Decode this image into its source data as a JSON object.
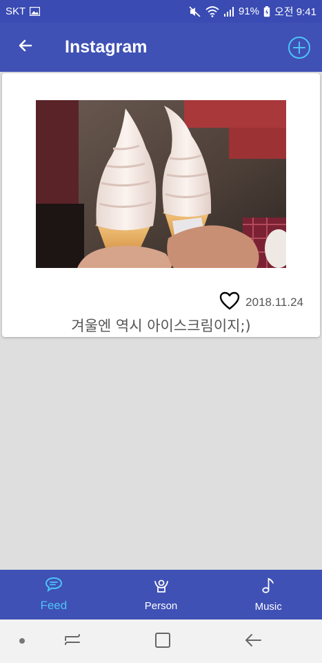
{
  "status_bar": {
    "carrier": "SKT",
    "battery": "91%",
    "time": "오전 9:41",
    "icons": [
      "gallery-icon",
      "mute-icon",
      "wifi-icon",
      "signal-icon",
      "battery-icon"
    ]
  },
  "app_bar": {
    "title": "Instagram",
    "back_icon": "arrow-left-icon",
    "add_icon": "add-circle-icon",
    "accent_color": "#4fc3f7"
  },
  "post": {
    "image_subject": "ice-cream-cones-photo",
    "like_icon": "heart-outline-icon",
    "date": "2018.11.24",
    "caption": "겨울엔 역시 아이스크림이지;)"
  },
  "bottom_nav": {
    "items": [
      {
        "label": "Feed",
        "icon": "chat-bubble-icon",
        "active": true
      },
      {
        "label": "Person",
        "icon": "person-icon",
        "active": false
      },
      {
        "label": "Music",
        "icon": "music-note-icon",
        "active": false
      }
    ]
  },
  "system_nav": {
    "buttons": [
      "dot-icon",
      "recent-apps-icon",
      "home-icon",
      "back-icon"
    ]
  },
  "colors": {
    "primary": "#3f51b5",
    "status_bar": "#3a4bb3",
    "background": "#dedede",
    "active_tab": "#4fc3f7"
  }
}
